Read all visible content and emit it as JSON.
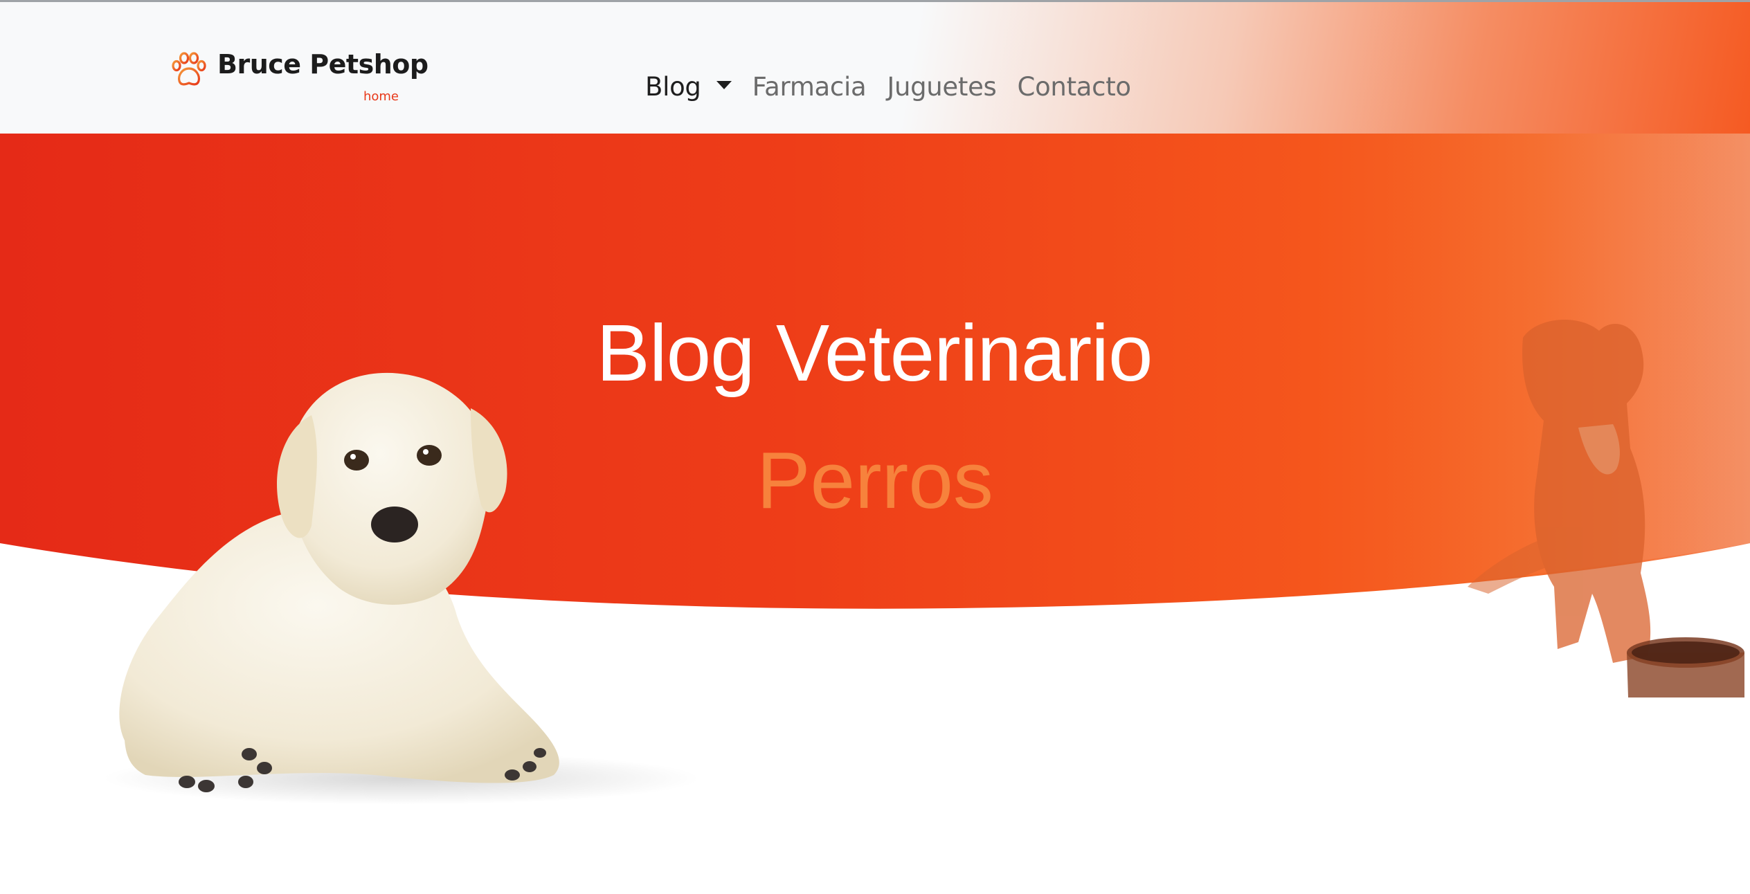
{
  "navbar": {
    "brand_name": "Bruce Petshop",
    "brand_sub": "home",
    "brand_icon": "paw-icon",
    "items": [
      {
        "label": "Blog",
        "active": true,
        "dropdown": true
      },
      {
        "label": "Farmacia",
        "active": false
      },
      {
        "label": "Juguetes",
        "active": false
      },
      {
        "label": "Contacto",
        "active": false
      }
    ]
  },
  "hero": {
    "title": "Blog Veterinario",
    "subtitle": "Perros",
    "colors": {
      "gradient_start": "#e52a17",
      "gradient_end": "#f56a2a",
      "subtitle": "#f7823c",
      "brand_accent": "#e8391a"
    }
  }
}
